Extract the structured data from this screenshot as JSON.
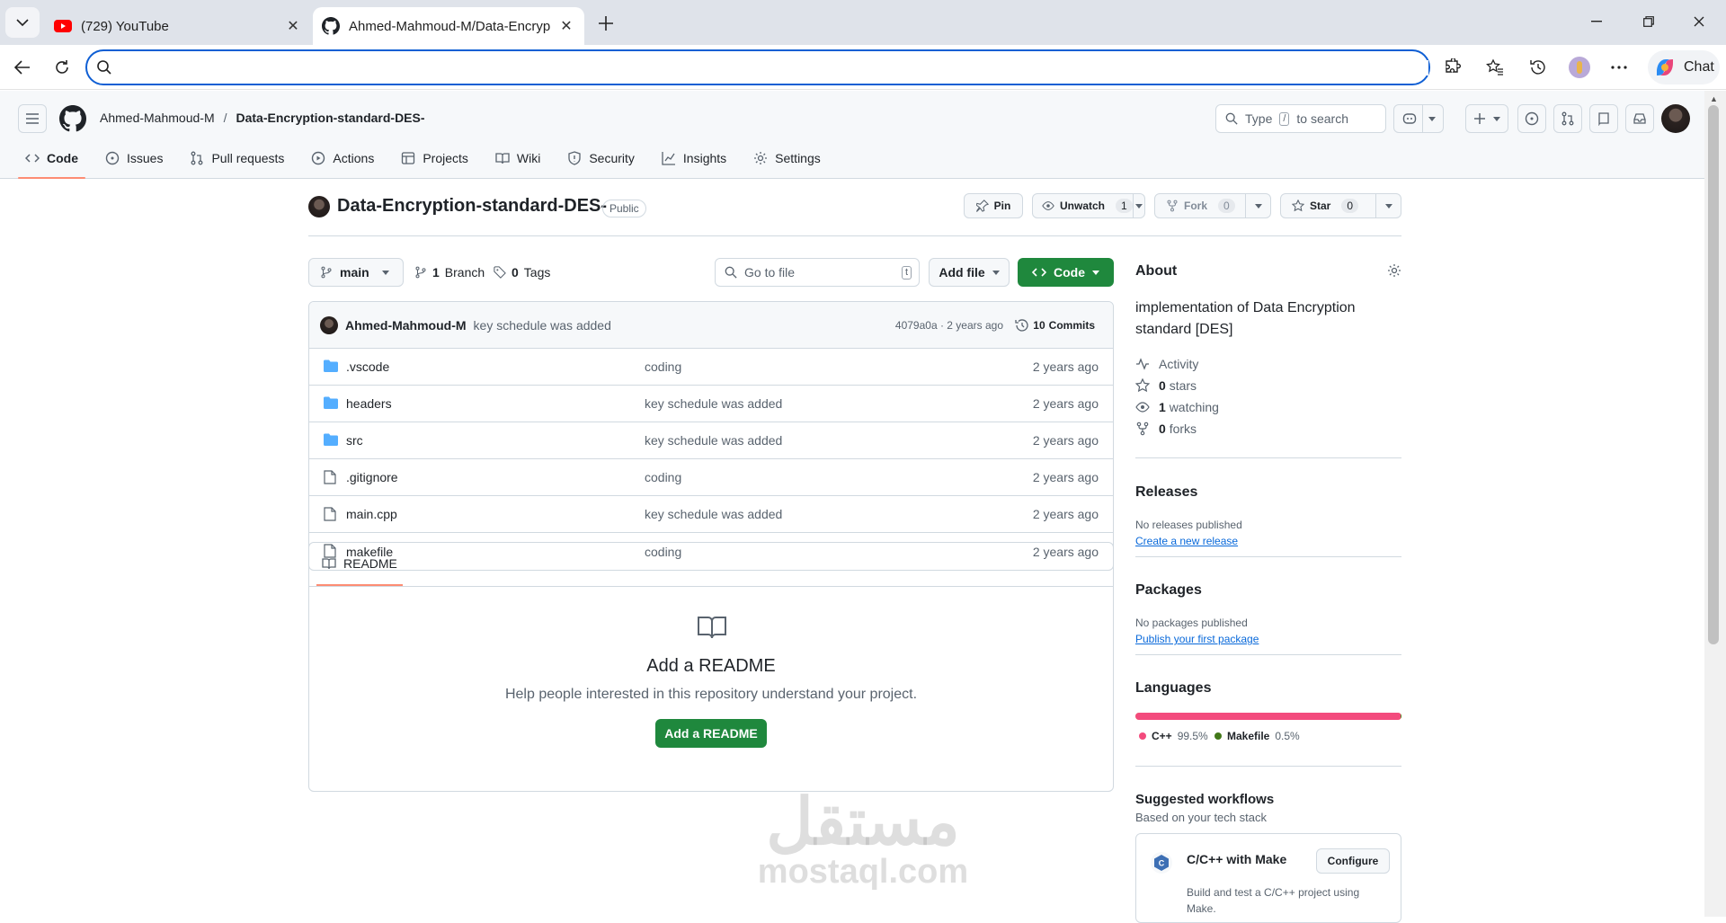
{
  "browser": {
    "tabs": [
      {
        "title": "(729) YouTube",
        "icon": "youtube-icon",
        "active": false
      },
      {
        "title": "Ahmed-Mahmoud-M/Data-Encryp",
        "icon": "github-icon",
        "active": true
      }
    ],
    "address_value": "",
    "chat_label": "Chat"
  },
  "github": {
    "owner": "Ahmed-Mahmoud-M",
    "separator": "/",
    "repo": "Data-Encryption-standard-DES-",
    "search_type": "Type",
    "search_key": "/",
    "search_rest": "to search",
    "nav": [
      {
        "label": "Code",
        "icon": "code-icon",
        "active": true
      },
      {
        "label": "Issues",
        "icon": "issue-icon"
      },
      {
        "label": "Pull requests",
        "icon": "pull-request-icon"
      },
      {
        "label": "Actions",
        "icon": "play-icon"
      },
      {
        "label": "Projects",
        "icon": "table-icon"
      },
      {
        "label": "Wiki",
        "icon": "book-icon"
      },
      {
        "label": "Security",
        "icon": "shield-icon"
      },
      {
        "label": "Insights",
        "icon": "graph-icon"
      },
      {
        "label": "Settings",
        "icon": "gear-icon"
      }
    ]
  },
  "repo": {
    "name": "Data-Encryption-standard-DES-",
    "visibility": "Public",
    "pin_label": "Pin",
    "unwatch_label": "Unwatch",
    "watch_count": "1",
    "fork_label": "Fork",
    "fork_count": "0",
    "star_label": "Star",
    "star_count": "0"
  },
  "toolbar": {
    "branch": "main",
    "branches_count": "1",
    "branches_label": "Branch",
    "tags_count": "0",
    "tags_label": "Tags",
    "goto_placeholder": "Go to file",
    "goto_key": "t",
    "add_file_label": "Add file",
    "code_label": "Code"
  },
  "latest_commit": {
    "author": "Ahmed-Mahmoud-M",
    "message": "key schedule was added",
    "sha_time": "4079a0a · 2 years ago",
    "commits_count": "10",
    "commits_label": "Commits"
  },
  "files": [
    {
      "name": ".vscode",
      "type": "folder",
      "commit": "coding",
      "time": "2 years ago"
    },
    {
      "name": "headers",
      "type": "folder",
      "commit": "key schedule was added",
      "time": "2 years ago"
    },
    {
      "name": "src",
      "type": "folder",
      "commit": "key schedule was added",
      "time": "2 years ago"
    },
    {
      "name": ".gitignore",
      "type": "file",
      "commit": "coding",
      "time": "2 years ago"
    },
    {
      "name": "main.cpp",
      "type": "file",
      "commit": "key schedule was added",
      "time": "2 years ago"
    },
    {
      "name": "makefile",
      "type": "file",
      "commit": "coding",
      "time": "2 years ago"
    }
  ],
  "readme": {
    "tab_label": "README",
    "heading": "Add a README",
    "text": "Help people interested in this repository understand your project.",
    "button": "Add a README"
  },
  "about": {
    "heading": "About",
    "description": "implementation of Data Encryption standard [DES]",
    "activity": "Activity",
    "stars_count": "0",
    "stars_label": "stars",
    "watching_count": "1",
    "watching_label": "watching",
    "forks_count": "0",
    "forks_label": "forks"
  },
  "releases": {
    "heading": "Releases",
    "empty": "No releases published",
    "link": "Create a new release"
  },
  "packages": {
    "heading": "Packages",
    "empty": "No packages published",
    "link": "Publish your first package"
  },
  "languages": {
    "heading": "Languages",
    "items": [
      {
        "name": "C++",
        "percent": "99.5%",
        "fraction": 0.995,
        "color": "#f34b7d"
      },
      {
        "name": "Makefile",
        "percent": "0.5%",
        "fraction": 0.005,
        "color": "#427819"
      }
    ]
  },
  "workflows": {
    "heading": "Suggested workflows",
    "subheading": "Based on your tech stack",
    "item_title": "C/C++ with Make",
    "item_button": "Configure",
    "item_desc": "Build and test a C/C++ project using Make."
  },
  "watermark": {
    "arabic": "مستقل",
    "latin": "mostaql.com"
  },
  "colors": {
    "accent": "#1f883d",
    "link": "#0969da",
    "tab_underline": "#fd8c73",
    "folder": "#54aeff"
  }
}
